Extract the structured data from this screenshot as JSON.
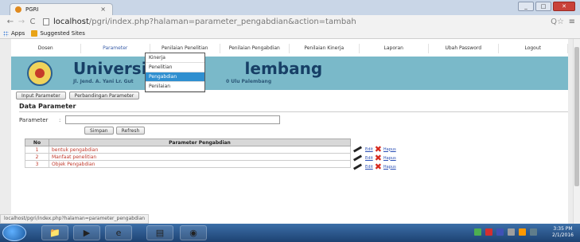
{
  "browser": {
    "tab_title": "PGRI",
    "tab_close": "×",
    "url_host": "localhost",
    "url_path": "/pgri/index.php?halaman=parameter_pengabdian&action=tambah",
    "bookmarks": [
      {
        "label": "Apps"
      },
      {
        "label": "Suggested Sites"
      }
    ],
    "status_url": "localhost/pgri/index.php?halaman=parameter_pengabdian"
  },
  "nav": {
    "items": [
      {
        "label": "Dosen"
      },
      {
        "label": "Parameter"
      },
      {
        "label": "Penilaian Penelitian"
      },
      {
        "label": "Penilaian Pengabdian"
      },
      {
        "label": "Penilaian Kinerja"
      },
      {
        "label": "Laporan"
      },
      {
        "label": "Ubah Password"
      },
      {
        "label": "Logout"
      }
    ],
    "dropdown": [
      {
        "label": "Kinerja"
      },
      {
        "label": "Penelitian"
      },
      {
        "label": "Pengabdian"
      },
      {
        "label": "Penilaian"
      }
    ]
  },
  "banner": {
    "title_left": "Universitas",
    "title_right": "lembang",
    "address_left": "Jl. Jend. A. Yani Lr. Gut",
    "address_right": "0 Ulu Palembang"
  },
  "subbuttons": {
    "input": "Input Parameter",
    "compare": "Perbandingan Parameter"
  },
  "form": {
    "title": "Data Parameter",
    "param_label": "Parameter",
    "param_colon": ":",
    "param_value": "",
    "save": "Simpan",
    "refresh": "Refresh"
  },
  "table": {
    "headers": {
      "no": "No",
      "param": "Parameter Pengabdian"
    },
    "rows": [
      {
        "no": "1",
        "param": "bentuk pengabdian"
      },
      {
        "no": "2",
        "param": "Manfaat penelitian"
      },
      {
        "no": "3",
        "param": "Objek Pengabdian"
      }
    ],
    "edit_label": "Edit",
    "delete_label": "Hapus"
  },
  "clock": {
    "time": "3:35 PM",
    "date": "2/1/2016"
  }
}
